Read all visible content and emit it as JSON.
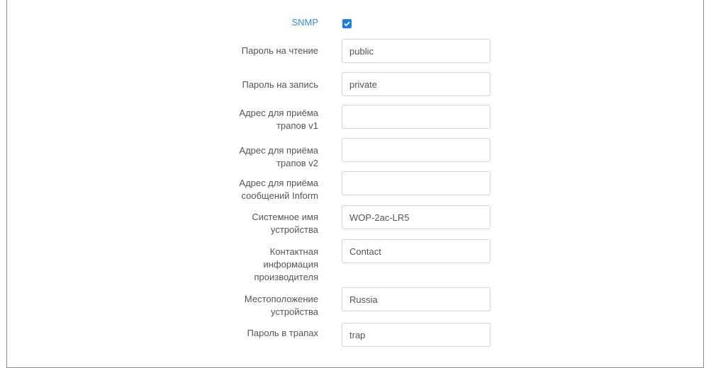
{
  "snmp": {
    "label": "SNMP",
    "checked": true
  },
  "fields": {
    "read_password": {
      "label": "Пароль на чтение",
      "value": "public"
    },
    "write_password": {
      "label": "Пароль на запись",
      "value": "private"
    },
    "trap_v1_address": {
      "label_line1": "Адрес для приёма",
      "label_line2": "трапов v1",
      "value": ""
    },
    "trap_v2_address": {
      "label_line1": "Адрес для приёма",
      "label_line2": "трапов v2",
      "value": ""
    },
    "inform_address": {
      "label_line1": "Адрес для приёма",
      "label_line2": "сообщений Inform",
      "value": ""
    },
    "system_name": {
      "label_line1": "Системное имя",
      "label_line2": "устройства",
      "value": "WOP-2ac-LR5"
    },
    "contact": {
      "label_line1": "Контактная",
      "label_line2": "информация",
      "label_line3": "производителя",
      "value": "Contact"
    },
    "location": {
      "label_line1": "Местоположение",
      "label_line2": "устройства",
      "value": "Russia"
    },
    "trap_password": {
      "label": "Пароль в трапах",
      "value": "trap"
    }
  },
  "colors": {
    "accent": "#1e7fe0",
    "link": "#3a8ad6",
    "text": "#555555",
    "border": "#d3d3d3"
  }
}
